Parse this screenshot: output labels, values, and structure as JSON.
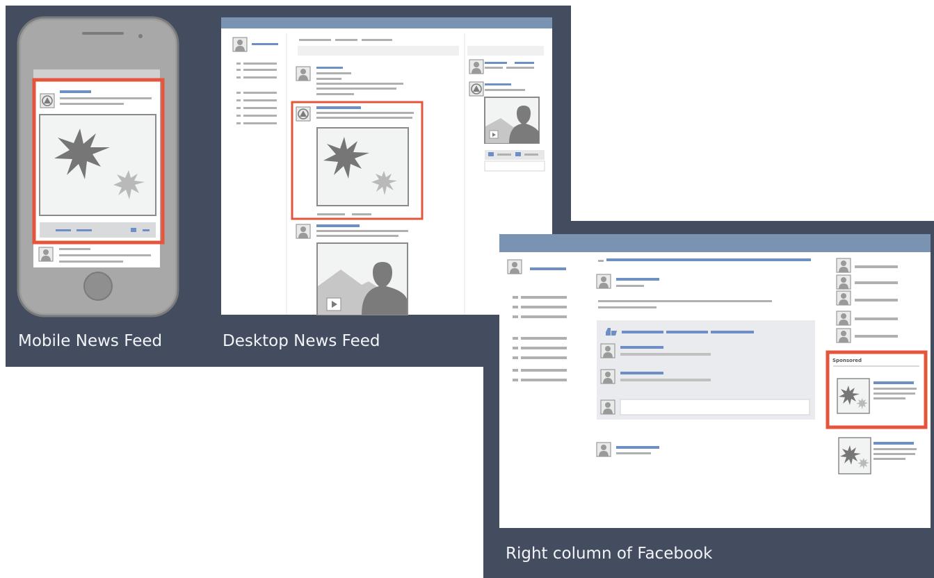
{
  "panels": {
    "mobile_caption": "Mobile News Feed",
    "desktop_caption": "Desktop News Feed",
    "right_column_caption": "Right column of Facebook"
  },
  "right_column": {
    "sponsored_label": "Sponsored"
  },
  "colors": {
    "panel_bg": "#434d5f",
    "highlight_red": "#e4553c",
    "header_blue": "#7b93b2",
    "link_blue": "#6d8fc6",
    "line_gray": "#a8a8a8",
    "image_placeholder": "#f2f3f3"
  },
  "icons": [
    "phone-frame-icon",
    "avatar-icon",
    "starburst-icon",
    "play-icon",
    "like-icon",
    "person-silhouette-icon",
    "mountain-icon"
  ]
}
